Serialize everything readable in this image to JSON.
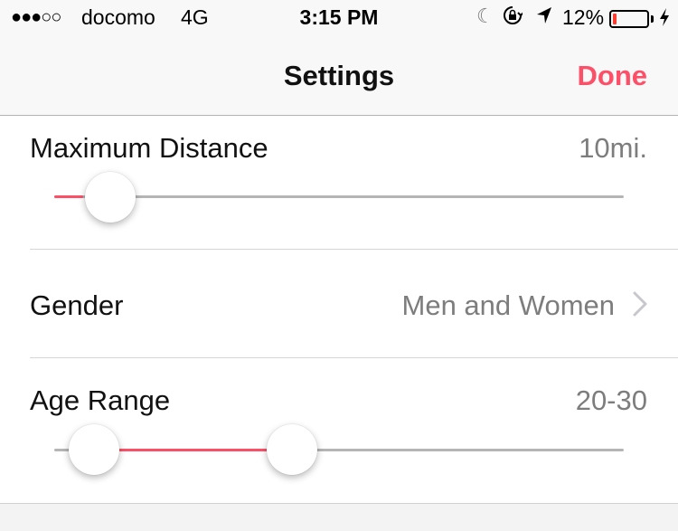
{
  "status_bar": {
    "signal": "●●●○○",
    "carrier": "docomo",
    "network": "4G",
    "time": "3:15 PM",
    "battery_percent": "12%",
    "battery_level": 0.12,
    "icons": [
      "moon-icon",
      "rotation-lock-icon",
      "location-arrow-icon",
      "battery-icon",
      "charging-bolt-icon"
    ]
  },
  "nav": {
    "title": "Settings",
    "done_label": "Done"
  },
  "settings": {
    "max_distance": {
      "label": "Maximum Distance",
      "value": "10mi.",
      "slider_fraction": 0.05
    },
    "gender": {
      "label": "Gender",
      "value": "Men and Women"
    },
    "age_range": {
      "label": "Age Range",
      "value": "20-30",
      "slider_low_fraction": 0.05,
      "slider_high_fraction": 0.37
    }
  },
  "colors": {
    "accent": "#fd5068",
    "value_gray": "#7d7d7d",
    "track_gray": "#b5b5b5"
  }
}
